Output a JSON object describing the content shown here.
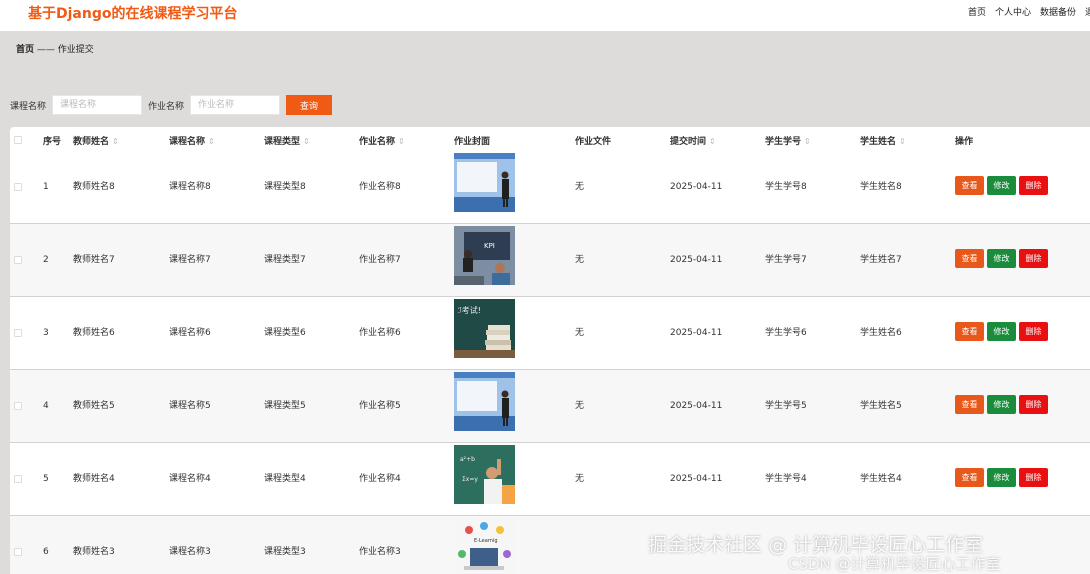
{
  "app": {
    "title": "基于Django的在线课程学习平台"
  },
  "topnav": [
    "首页",
    "个人中心",
    "数据备份",
    "退"
  ],
  "breadcrumb": {
    "home": "首页",
    "sep": "——",
    "current": "作业提交"
  },
  "search": {
    "course_label": "课程名称",
    "course_placeholder": "课程名称",
    "homework_label": "作业名称",
    "homework_placeholder": "作业名称",
    "query_label": "查询"
  },
  "table": {
    "headers": [
      "序号",
      "教师姓名",
      "课程名称",
      "课程类型",
      "作业名称",
      "作业封面",
      "作业文件",
      "提交时间",
      "学生学号",
      "学生姓名",
      "操作"
    ],
    "actions": {
      "view": "查看",
      "edit": "修改",
      "delete": "删除"
    },
    "rows": [
      {
        "no": "1",
        "teacher": "教师姓名8",
        "course": "课程名称8",
        "type": "课程类型8",
        "homework": "作业名称8",
        "cover": "presenter-slide",
        "file": "无",
        "time": "2025-04-11",
        "student_id": "学生学号8",
        "student_name": "学生姓名8"
      },
      {
        "no": "2",
        "teacher": "教师姓名7",
        "course": "课程名称7",
        "type": "课程类型7",
        "homework": "作业名称7",
        "cover": "kpi-board",
        "file": "无",
        "time": "2025-04-11",
        "student_id": "学生学号7",
        "student_name": "学生姓名7"
      },
      {
        "no": "3",
        "teacher": "教师姓名6",
        "course": "课程名称6",
        "type": "课程类型6",
        "homework": "作业名称6",
        "cover": "chalkboard-books",
        "file": "无",
        "time": "2025-04-11",
        "student_id": "学生学号6",
        "student_name": "学生姓名6"
      },
      {
        "no": "4",
        "teacher": "教师姓名5",
        "course": "课程名称5",
        "type": "课程类型5",
        "homework": "作业名称5",
        "cover": "presenter-slide",
        "file": "无",
        "time": "2025-04-11",
        "student_id": "学生学号5",
        "student_name": "学生姓名5"
      },
      {
        "no": "5",
        "teacher": "教师姓名4",
        "course": "课程名称4",
        "type": "课程类型4",
        "homework": "作业名称4",
        "cover": "student-chalkboard",
        "file": "无",
        "time": "2025-04-11",
        "student_id": "学生学号4",
        "student_name": "学生姓名4"
      },
      {
        "no": "6",
        "teacher": "教师姓名3",
        "course": "课程名称3",
        "type": "课程类型3",
        "homework": "作业名称3",
        "cover": "e-learning-icons",
        "file": "",
        "time": "",
        "student_id": "",
        "student_name": ""
      }
    ]
  },
  "watermark": {
    "line1": "掘金技术社区 @ 计算机毕设匠心工作室",
    "line2": "CSDN @计算机毕设匠心工作室"
  },
  "colors": {
    "brand": "#f05a14",
    "view": "#e8581a",
    "edit": "#1a8c3c",
    "delete": "#e81010"
  }
}
